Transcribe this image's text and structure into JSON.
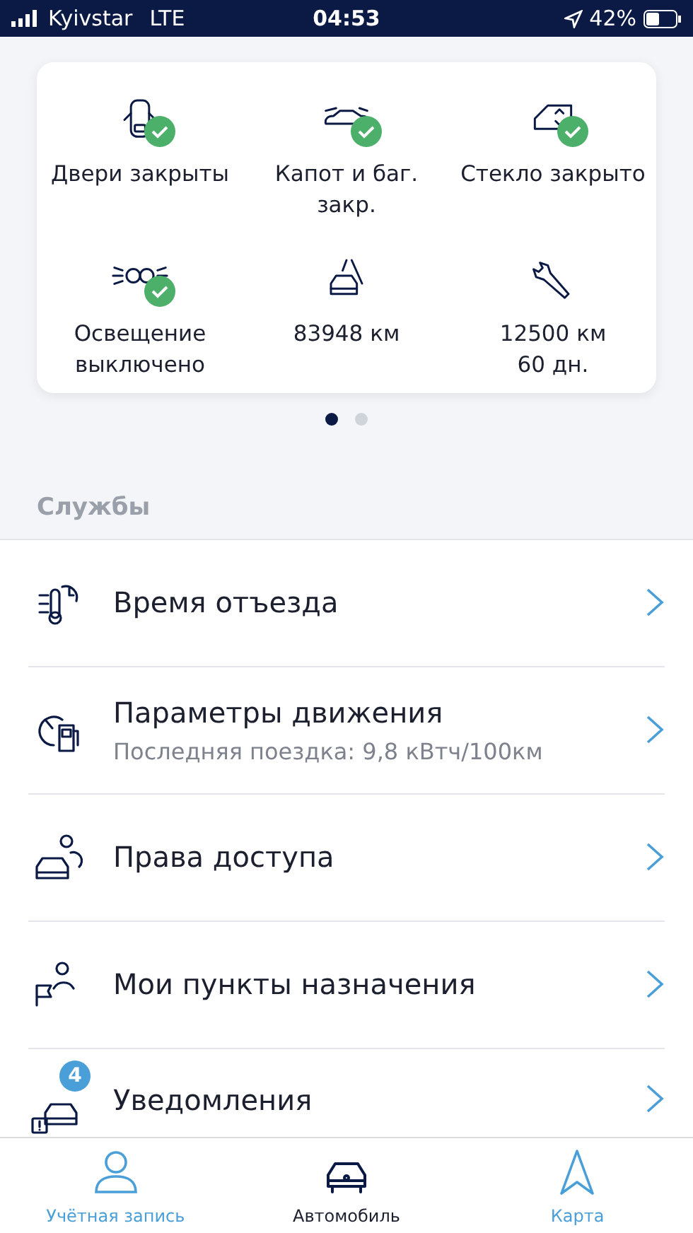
{
  "status_bar": {
    "carrier": "Kyivstar",
    "network": "LTE",
    "time": "04:53",
    "battery": "42%"
  },
  "vehicle_status": {
    "tiles": [
      {
        "label": "Двери закрыты",
        "checked": true
      },
      {
        "label": "Капот и баг. закр.",
        "checked": true
      },
      {
        "label": "Стекло закрыто",
        "checked": true
      },
      {
        "label": "Освещение выключено",
        "checked": true
      },
      {
        "label": "83948 км",
        "checked": false
      },
      {
        "label": "12500 км\n60 дн.",
        "checked": false
      }
    ],
    "pages": [
      {
        "selected": true
      },
      {
        "selected": false
      }
    ]
  },
  "services": {
    "title": "Службы",
    "items": [
      {
        "title": "Время отъезда"
      },
      {
        "title": "Параметры движения",
        "subtitle": "Последняя поездка: 9,8 кВтч/100км"
      },
      {
        "title": "Права доступа"
      },
      {
        "title": "Мои пункты назначения"
      },
      {
        "title": "Уведомления",
        "badge": "4"
      }
    ]
  },
  "tab_bar": [
    {
      "label": "Учётная запись",
      "selected": false
    },
    {
      "label": "Автомобиль",
      "selected": true
    },
    {
      "label": "Карта",
      "selected": false
    }
  ]
}
